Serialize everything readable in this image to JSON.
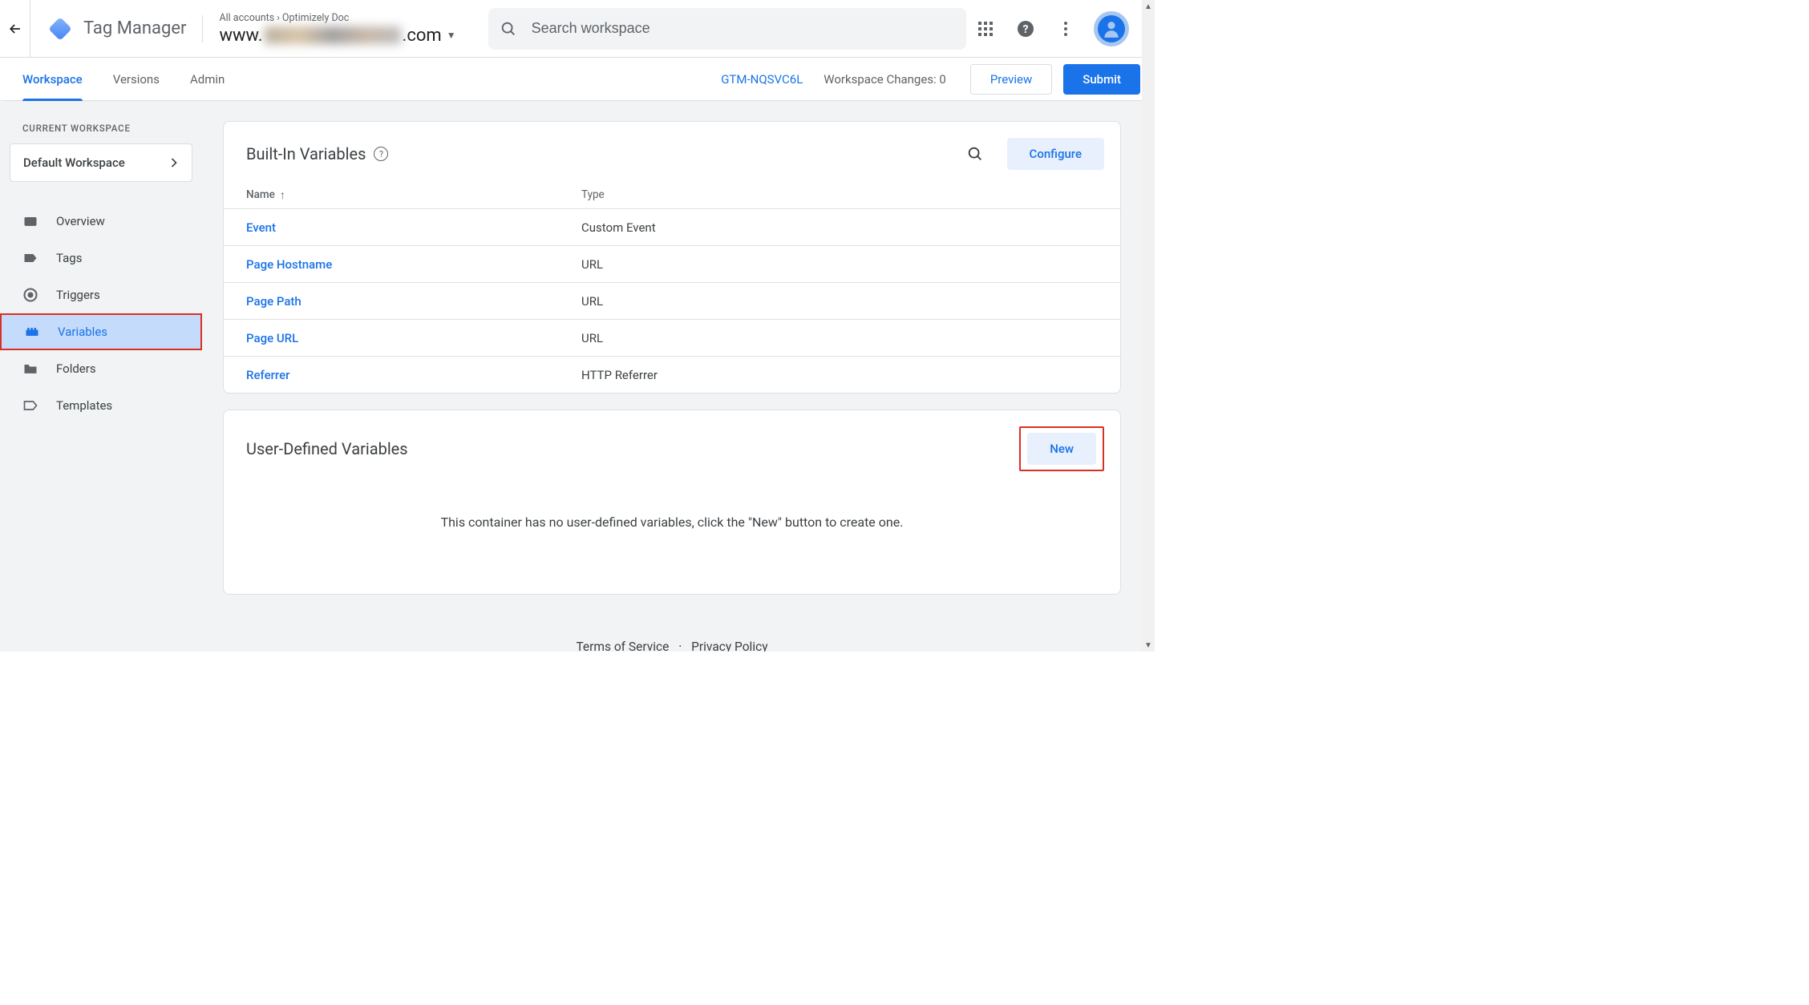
{
  "header": {
    "product_name": "Tag Manager",
    "breadcrumb": [
      "All accounts",
      "Optimizely Doc"
    ],
    "domain_prefix": "www.",
    "domain_suffix": ".com",
    "search_placeholder": "Search workspace"
  },
  "nav": {
    "tabs": [
      {
        "id": "workspace",
        "label": "Workspace",
        "active": true
      },
      {
        "id": "versions",
        "label": "Versions",
        "active": false
      },
      {
        "id": "admin",
        "label": "Admin",
        "active": false
      }
    ],
    "container_id": "GTM-NQSVC6L",
    "changes_label": "Workspace Changes: 0",
    "preview_label": "Preview",
    "submit_label": "Submit"
  },
  "sidebar": {
    "current_workspace_label": "CURRENT WORKSPACE",
    "workspace_name": "Default Workspace",
    "items": [
      {
        "id": "overview",
        "label": "Overview"
      },
      {
        "id": "tags",
        "label": "Tags"
      },
      {
        "id": "triggers",
        "label": "Triggers"
      },
      {
        "id": "variables",
        "label": "Variables"
      },
      {
        "id": "folders",
        "label": "Folders"
      },
      {
        "id": "templates",
        "label": "Templates"
      }
    ],
    "active": "variables"
  },
  "builtin": {
    "title": "Built-In Variables",
    "configure_label": "Configure",
    "columns": {
      "name": "Name",
      "type": "Type"
    },
    "rows": [
      {
        "name": "Event",
        "type": "Custom Event"
      },
      {
        "name": "Page Hostname",
        "type": "URL"
      },
      {
        "name": "Page Path",
        "type": "URL"
      },
      {
        "name": "Page URL",
        "type": "URL"
      },
      {
        "name": "Referrer",
        "type": "HTTP Referrer"
      }
    ]
  },
  "userdef": {
    "title": "User-Defined Variables",
    "new_label": "New",
    "empty_message": "This container has no user-defined variables, click the \"New\" button to create one."
  },
  "footer": {
    "terms": "Terms of Service",
    "privacy": "Privacy Policy"
  }
}
